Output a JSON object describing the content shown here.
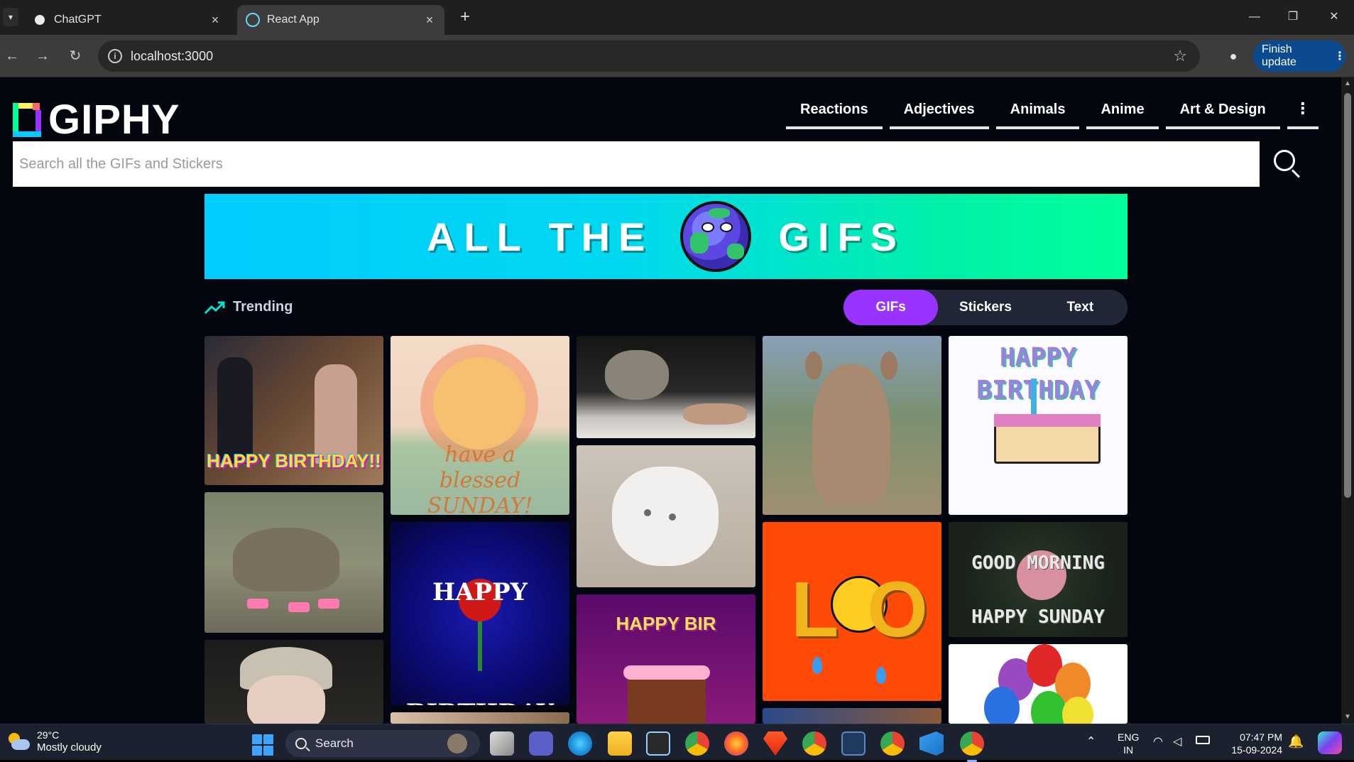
{
  "browser": {
    "tabs": [
      {
        "title": "ChatGPT",
        "active": false
      },
      {
        "title": "React App",
        "active": true
      }
    ],
    "new_tab_label": "+",
    "url": "localhost:3000",
    "finish_update_label": "Finish update",
    "window_controls": {
      "minimize": "—",
      "restore": "❐",
      "close": "✕"
    }
  },
  "page": {
    "logo_text": "GIPHY",
    "nav": [
      "Reactions",
      "Adjectives",
      "Animals",
      "Anime",
      "Art & Design"
    ],
    "nav_more": "⋮",
    "search_placeholder": "Search all the GIFs and Stickers",
    "banner": {
      "left_text": "ALL THE",
      "right_text": "GIFS"
    },
    "trending_label": "Trending",
    "content_tabs": [
      {
        "label": "GIFs",
        "selected": true
      },
      {
        "label": "Stickers",
        "selected": false
      },
      {
        "label": "Text",
        "selected": false
      }
    ],
    "gifs": [
      {
        "id": "office-birthday",
        "caption": "HAPPY BIRTHDAY!!",
        "colors": [
          "#3a2a22",
          "#7a5a44"
        ]
      },
      {
        "id": "elephant",
        "caption": "",
        "colors": [
          "#8a8a6a",
          "#6f7160"
        ]
      },
      {
        "id": "laughing-man",
        "caption": "",
        "colors": [
          "#e8e0d8",
          "#a89a8a"
        ]
      },
      {
        "id": "blessed-sunday",
        "caption": "have a blessed SUNDAY!",
        "colors": [
          "#f4d8c0",
          "#a8c8a0"
        ]
      },
      {
        "id": "happy-birthday-rose",
        "caption": "HAPPY BIRTHDAY",
        "colors": [
          "#0a0a6a",
          "#1a1aa8"
        ]
      },
      {
        "id": "cat-bed",
        "caption": "",
        "colors": [
          "#1a1a1a",
          "#4a4a4a"
        ]
      },
      {
        "id": "white-cat",
        "caption": "",
        "colors": [
          "#e0d8d0",
          "#b0a8a0"
        ]
      },
      {
        "id": "birthday-cake-purple",
        "caption": "HAPPY BIR",
        "colors": [
          "#6a1a7a",
          "#a03090"
        ]
      },
      {
        "id": "kangaroo",
        "caption": "",
        "colors": [
          "#8a9ab0",
          "#a08a70"
        ]
      },
      {
        "id": "lol-emoji",
        "caption": "LOL",
        "colors": [
          "#ff4a10",
          "#ff5a00"
        ]
      },
      {
        "id": "happy-birthday-cake",
        "caption": "HAPPY BIRTHDAY",
        "colors": [
          "#ffffff",
          "#f4f0ff"
        ]
      },
      {
        "id": "good-morning-sunday",
        "caption": "GOOD MORNING HAPPY SUNDAY",
        "colors": [
          "#1a2a1a",
          "#3a4a3a"
        ]
      },
      {
        "id": "balloons",
        "caption": "",
        "colors": [
          "#ffffff",
          "#ffffff"
        ]
      }
    ]
  },
  "taskbar": {
    "weather_temp": "29°C",
    "weather_condition": "Mostly cloudy",
    "search_label": "Search",
    "lang_top": "ENG",
    "lang_bottom": "IN",
    "time": "07:47 PM",
    "date": "15-09-2024"
  }
}
